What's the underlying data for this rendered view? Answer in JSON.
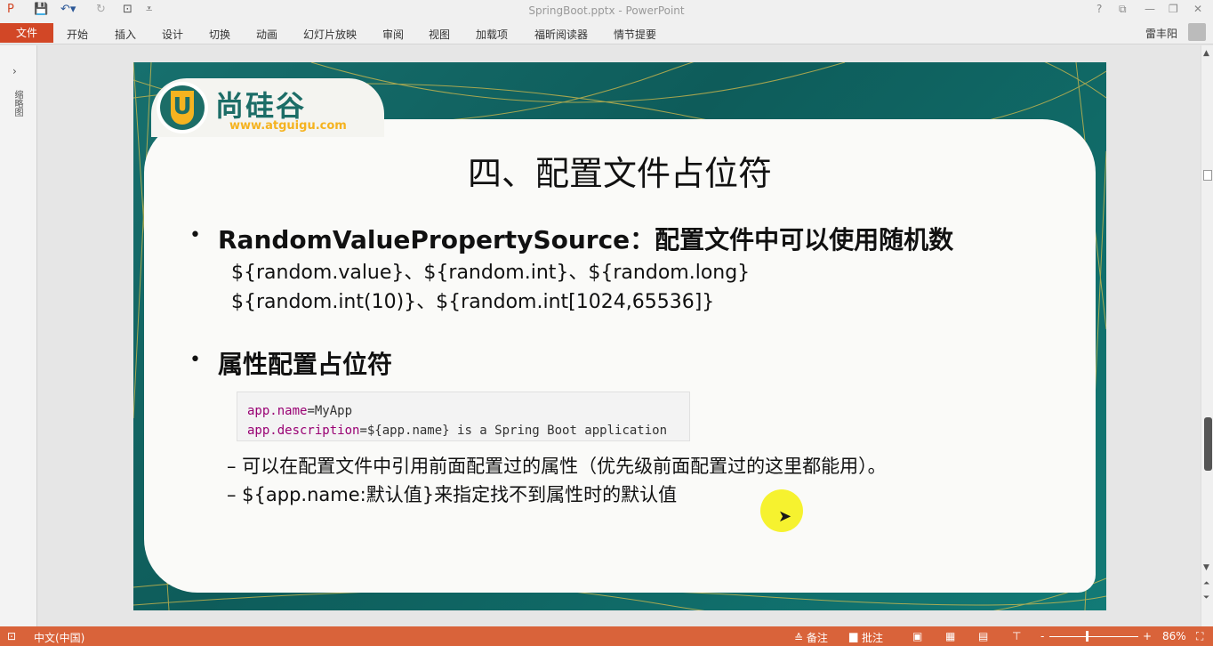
{
  "titlebar": {
    "title": "SpringBoot.pptx - PowerPoint",
    "help": "?",
    "min": "—",
    "restore": "❐",
    "close": "✕"
  },
  "ribbon": {
    "file": "文件",
    "tabs": [
      "开始",
      "插入",
      "设计",
      "切换",
      "动画",
      "幻灯片放映",
      "审阅",
      "视图",
      "加载项",
      "福昕阅读器",
      "情节提要"
    ],
    "user": "雷丰阳"
  },
  "leftpane": {
    "label": "缩略图",
    "chevron": "›"
  },
  "slide": {
    "logo": {
      "cn": "尚硅谷",
      "url": "www.atguigu.com",
      "letter": "U"
    },
    "title": "四、配置文件占位符",
    "bullet1": "RandomValuePropertySource：配置文件中可以使用随机数",
    "line1": "${random.value}、${random.int}、${random.long}",
    "line2": "${random.int(10)}、${random.int[1024,65536]}",
    "bullet2": "属性配置占位符",
    "code": [
      {
        "key": "app.name",
        "val": "=MyApp"
      },
      {
        "key": "app.description",
        "val": "=${app.name} is a Spring Boot application"
      }
    ],
    "dash1": "– 可以在配置文件中引用前面配置过的属性（优先级前面配置过的这里都能用）。",
    "dash2": "– ${app.name:默认值}来指定找不到属性时的默认值"
  },
  "status": {
    "lang": "中文(中国)",
    "notes": "≙ 备注",
    "comments": "批注",
    "zoom": "86%"
  },
  "colors": {
    "accent": "#d24726",
    "slide_bg": "#0e5c5a",
    "logo_yellow": "#f5b320"
  }
}
